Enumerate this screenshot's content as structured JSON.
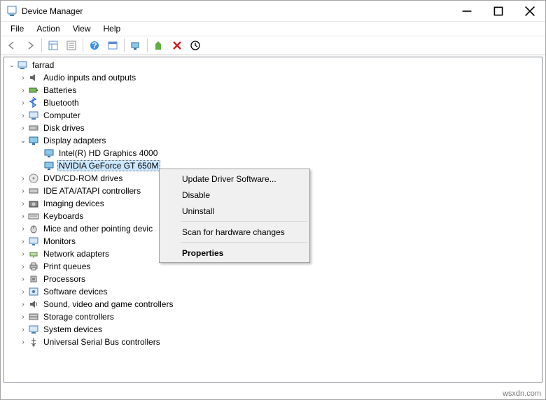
{
  "titlebar": {
    "title": "Device Manager"
  },
  "menubar": {
    "file": "File",
    "action": "Action",
    "view": "View",
    "help": "Help"
  },
  "tree": {
    "root": "farrad",
    "items": {
      "audio": "Audio inputs and outputs",
      "batteries": "Batteries",
      "bluetooth": "Bluetooth",
      "computer": "Computer",
      "disk": "Disk drives",
      "display": "Display adapters",
      "display_0": "Intel(R) HD Graphics 4000",
      "display_1": "NVIDIA GeForce GT 650M",
      "dvd": "DVD/CD-ROM drives",
      "ide": "IDE ATA/ATAPI controllers",
      "imaging": "Imaging devices",
      "keyboards": "Keyboards",
      "mice": "Mice and other pointing devic",
      "monitors": "Monitors",
      "network": "Network adapters",
      "print": "Print queues",
      "processors": "Processors",
      "software": "Software devices",
      "sound": "Sound, video and game controllers",
      "storage": "Storage controllers",
      "system": "System devices",
      "usb": "Universal Serial Bus controllers"
    }
  },
  "contextmenu": {
    "update": "Update Driver Software...",
    "disable": "Disable",
    "uninstall": "Uninstall",
    "scan": "Scan for hardware changes",
    "properties": "Properties"
  },
  "watermark": "wsxdn.com"
}
